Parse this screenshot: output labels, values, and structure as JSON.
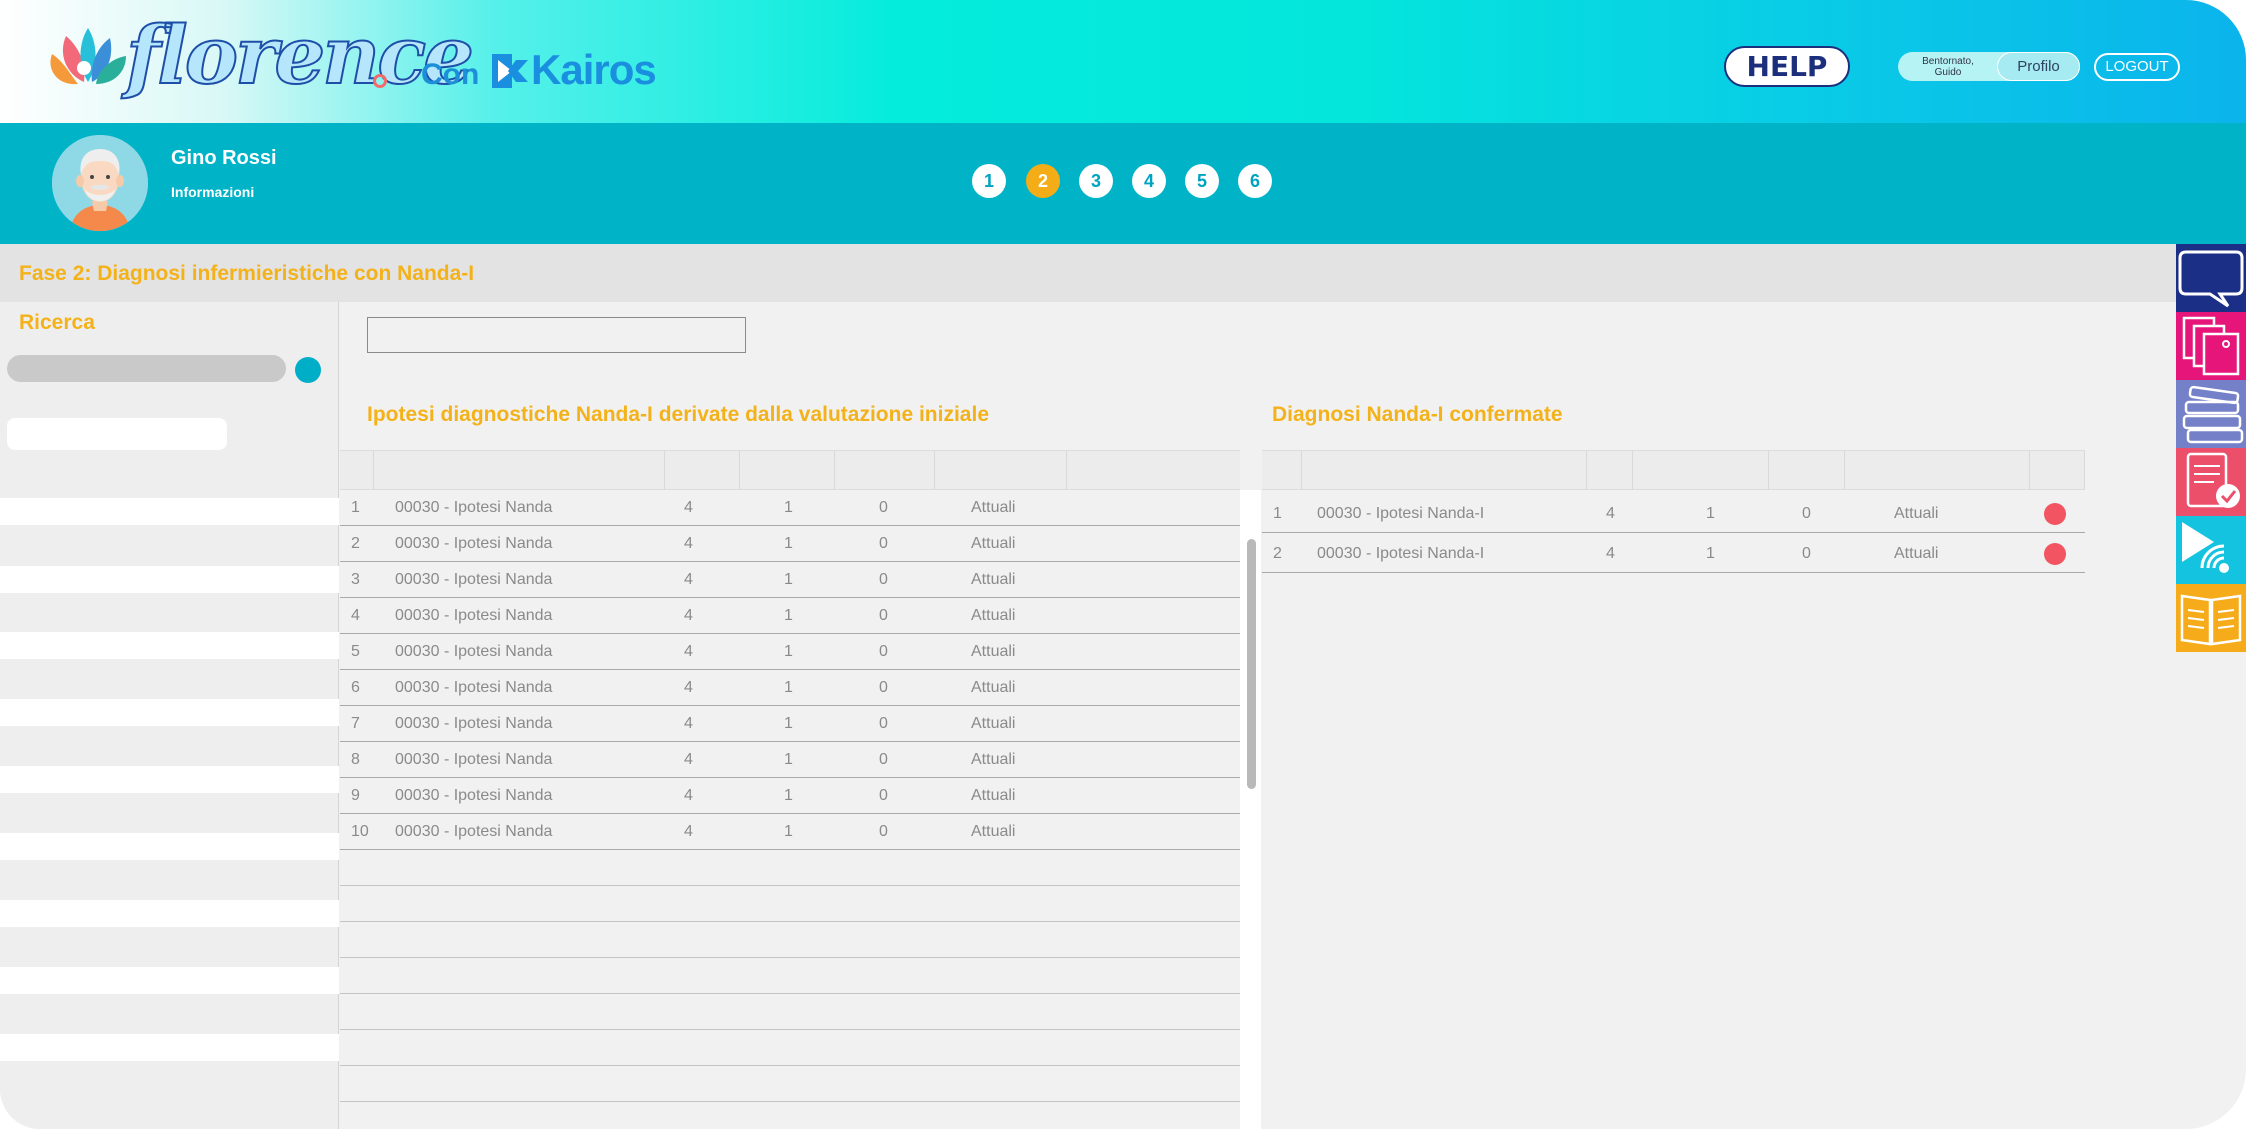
{
  "brand": {
    "logo_text": "florence",
    "with_label": "Con",
    "partner_name": "Kairos"
  },
  "header": {
    "help_label": "HELP",
    "greeting_line1": "Bentornato,",
    "greeting_line2": "Guido",
    "profile_label": "Profilo",
    "logout_label": "LOGOUT"
  },
  "patient": {
    "name": "Gino Rossi",
    "info_label": "Informazioni"
  },
  "steps": {
    "s1": "1",
    "s2": "2",
    "s3": "3",
    "s4": "4",
    "s5": "5",
    "s6": "6",
    "active": "2"
  },
  "phase": {
    "title": "Fase 2: Diagnosi infermieristiche con Nanda-I"
  },
  "search": {
    "title": "Ricerca"
  },
  "hypotheses": {
    "title": "Ipotesi diagnostiche Nanda-I derivate dalla valutazione iniziale",
    "rows": [
      {
        "n": "1",
        "label": "00030 - Ipotesi Nanda",
        "a": "4",
        "b": "1",
        "c": "0",
        "status": "Attuali"
      },
      {
        "n": "2",
        "label": "00030 - Ipotesi Nanda",
        "a": "4",
        "b": "1",
        "c": "0",
        "status": "Attuali"
      },
      {
        "n": "3",
        "label": "00030 - Ipotesi Nanda",
        "a": "4",
        "b": "1",
        "c": "0",
        "status": "Attuali"
      },
      {
        "n": "4",
        "label": "00030 - Ipotesi Nanda",
        "a": "4",
        "b": "1",
        "c": "0",
        "status": "Attuali"
      },
      {
        "n": "5",
        "label": "00030 - Ipotesi Nanda",
        "a": "4",
        "b": "1",
        "c": "0",
        "status": "Attuali"
      },
      {
        "n": "6",
        "label": "00030 - Ipotesi Nanda",
        "a": "4",
        "b": "1",
        "c": "0",
        "status": "Attuali"
      },
      {
        "n": "7",
        "label": "00030 - Ipotesi Nanda",
        "a": "4",
        "b": "1",
        "c": "0",
        "status": "Attuali"
      },
      {
        "n": "8",
        "label": "00030 - Ipotesi Nanda",
        "a": "4",
        "b": "1",
        "c": "0",
        "status": "Attuali"
      },
      {
        "n": "9",
        "label": "00030 - Ipotesi Nanda",
        "a": "4",
        "b": "1",
        "c": "0",
        "status": "Attuali"
      },
      {
        "n": "10",
        "label": "00030 - Ipotesi Nanda",
        "a": "4",
        "b": "1",
        "c": "0",
        "status": "Attuali"
      }
    ]
  },
  "confirmed": {
    "title": "Diagnosi Nanda-I confermate",
    "rows": [
      {
        "n": "1",
        "label": "00030 - Ipotesi Nanda-I",
        "a": "4",
        "b": "1",
        "c": "0",
        "status": "Attuali"
      },
      {
        "n": "2",
        "label": "00030 - Ipotesi Nanda-I",
        "a": "4",
        "b": "1",
        "c": "0",
        "status": "Attuali"
      }
    ]
  },
  "tools": [
    "chat-icon",
    "documents-icon",
    "library-icon",
    "checked-report-icon",
    "media-play-icon",
    "open-book-icon"
  ],
  "colors": {
    "accent": "#f4b21a",
    "teal": "#00b3c7",
    "delete": "#f25462",
    "help_navy": "#1b2f7d"
  }
}
